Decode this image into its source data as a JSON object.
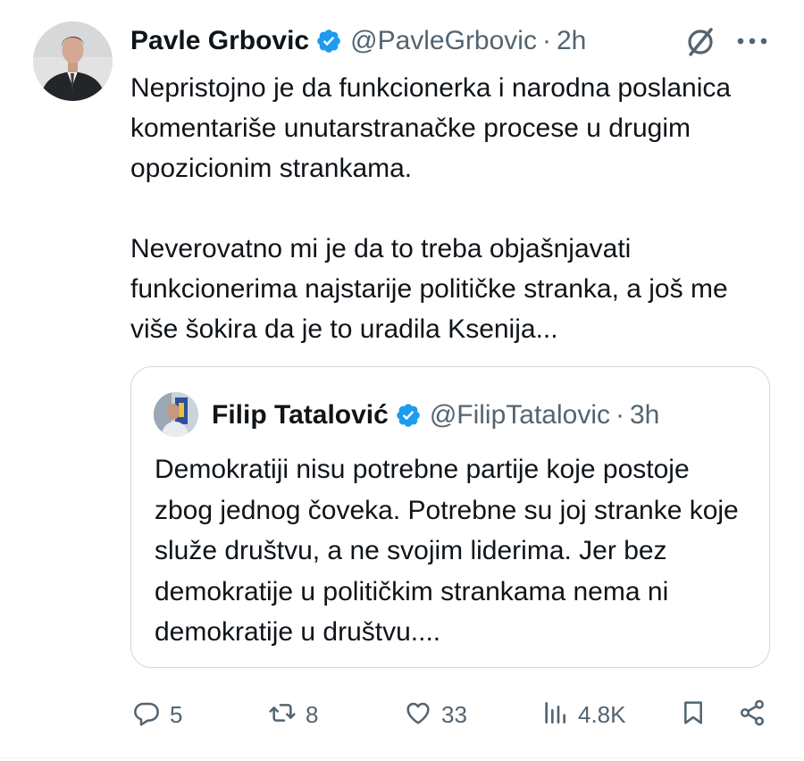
{
  "author": {
    "name": "Pavle Grbovic",
    "handle": "@PavleGrbovic",
    "separator": "·",
    "time": "2h"
  },
  "tweet": {
    "paragraphs": [
      "Nepristojno je da funkcionerka i narodna poslanica komentariše unutarstranačke procese u drugim opozicionim strankama.",
      "Neverovatno mi je da to treba objašnjavati funkcionerima najstarije političke stranka, a još me više šokira da je to uradila Ksenija..."
    ]
  },
  "quoted": {
    "name": "Filip Tatalović",
    "handle": "@FilipTatalovic",
    "separator": "·",
    "time": "3h",
    "text": "Demokratiji nisu potrebne partije koje postoje zbog jednog čoveka. Potrebne su joj stranke koje služe društvu, a ne svojim liderima. Jer bez demokratije u političkim strankama nema ni demokratije u društvu...."
  },
  "actions": {
    "replies": "5",
    "reposts": "8",
    "likes": "33",
    "views": "4.8K"
  },
  "icons": [
    "verified-badge-icon",
    "grok-icon",
    "more-icon",
    "reply-icon",
    "repost-icon",
    "like-icon",
    "views-icon",
    "bookmark-icon",
    "share-icon"
  ],
  "colors": {
    "text": "#0f1419",
    "secondary": "#536471",
    "verified": "#1d9bf0",
    "border": "#cfd9de"
  }
}
